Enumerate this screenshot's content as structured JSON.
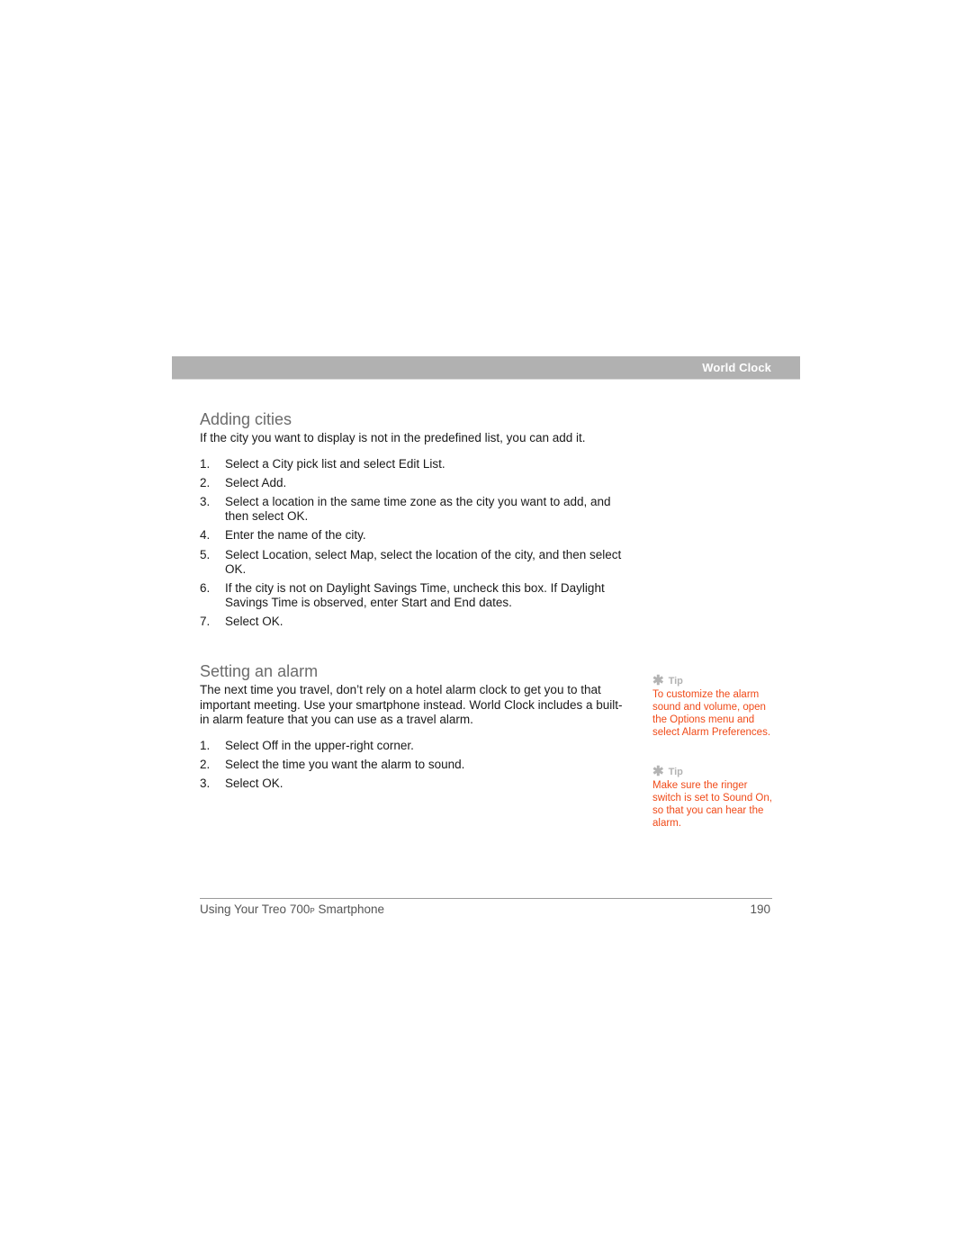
{
  "header": {
    "title": "World Clock",
    "bar_color": "#b1b1b1"
  },
  "sections": [
    {
      "heading": "Adding cities",
      "intro": "If the city you want to display is not in the predefined list, you can add it.",
      "steps": [
        {
          "num": "1.",
          "text": "Select a City pick list and select Edit List."
        },
        {
          "num": "2.",
          "text": "Select Add."
        },
        {
          "num": "3.",
          "text": "Select a location in the same time zone as the city you want to add, and then select OK."
        },
        {
          "num": "4.",
          "text": "Enter the name of the city."
        },
        {
          "num": "5.",
          "text": "Select Location, select Map, select the location of the city, and then select OK."
        },
        {
          "num": "6.",
          "text": "If the city is not on Daylight Savings Time, uncheck this box. If Daylight Savings Time is observed, enter Start and End dates."
        },
        {
          "num": "7.",
          "text": "Select OK."
        }
      ]
    },
    {
      "heading": "Setting an alarm",
      "intro": "The next time you travel, don’t rely on a hotel alarm clock to get you to that important meeting. Use your smartphone instead. World Clock includes a built-in alarm feature that you can use as a travel alarm.",
      "steps": [
        {
          "num": "1.",
          "text": "Select Off in the upper-right corner."
        },
        {
          "num": "2.",
          "text": "Select the time you want the alarm to sound."
        },
        {
          "num": "3.",
          "text": "Select OK."
        }
      ]
    }
  ],
  "tips": [
    {
      "icon": "asterisk-icon",
      "label": "Tip",
      "text": "To customize the alarm sound and volume, open the Options menu and select Alarm Preferences."
    },
    {
      "icon": "asterisk-icon",
      "label": "Tip",
      "text": "Make sure the ringer switch is set to Sound On, so that you can hear the alarm."
    }
  ],
  "colors": {
    "tip_text": "#f04a18",
    "tip_label": "#b3b3b3",
    "heading": "#6b6b6b"
  },
  "footer": {
    "book_title_prefix": "Using Your Treo 700",
    "book_title_model_suffix": "P",
    "book_title_suffix": " Smartphone",
    "page_number": "190"
  }
}
